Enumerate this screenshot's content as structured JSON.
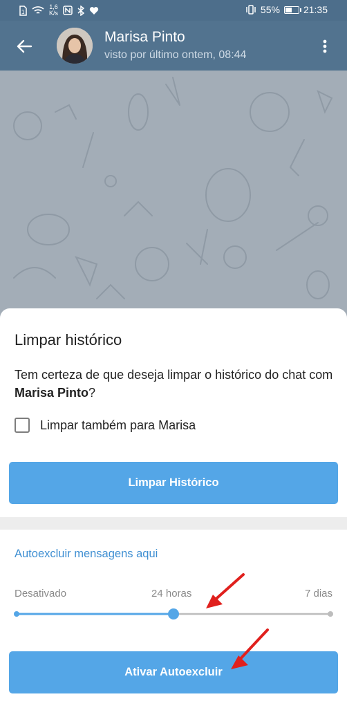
{
  "status_bar": {
    "speed_value": "1,6",
    "speed_unit": "K/s",
    "battery_percent": "55%",
    "time": "21:35",
    "battery_level": 0.55,
    "icons": [
      "sim-icon",
      "wifi-icon",
      "nfc-icon",
      "bluetooth-icon",
      "heart-icon",
      "vibrate-icon",
      "battery-icon"
    ]
  },
  "header": {
    "name": "Marisa Pinto",
    "last_seen": "visto por último ontem, 08:44",
    "color": "#52738f"
  },
  "dialog": {
    "title": "Limpar histórico",
    "message_prefix": "Tem certeza de que deseja limpar o histórico do chat com ",
    "message_name": "Marisa Pinto",
    "message_suffix": "?",
    "checkbox_label": "Limpar também para Marisa",
    "checkbox_checked": false,
    "clear_button": "Limpar Histórico",
    "accent_color": "#54a6e7"
  },
  "autodelete": {
    "section_title": "Autoexcluir mensagens aqui",
    "options": [
      "Desativado",
      "24 horas",
      "7 dias"
    ],
    "selected_option": "24 horas",
    "activate_button": "Ativar Autoexcluir"
  }
}
